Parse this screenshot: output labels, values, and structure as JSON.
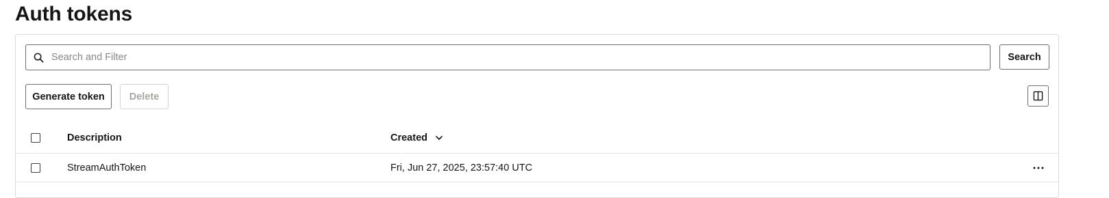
{
  "page": {
    "title": "Auth tokens"
  },
  "search": {
    "placeholder": "Search and Filter",
    "value": "",
    "button_label": "Search"
  },
  "toolbar": {
    "generate_label": "Generate token",
    "delete_label": "Delete"
  },
  "table": {
    "columns": [
      {
        "label": "Description"
      },
      {
        "label": "Created",
        "sort": "descending"
      }
    ],
    "rows": [
      {
        "description": "StreamAuthToken",
        "created": "Fri, Jun 27, 2025, 23:57:40 UTC"
      }
    ]
  },
  "icons": {
    "search": "search-icon",
    "columns": "columns-icon",
    "sort": "chevron-down-icon",
    "row_actions": "more-horizontal-icon"
  },
  "colors": {
    "border": "#6f6c69",
    "disabled": "#a9a5a1",
    "divider": "#e6e4e1"
  }
}
